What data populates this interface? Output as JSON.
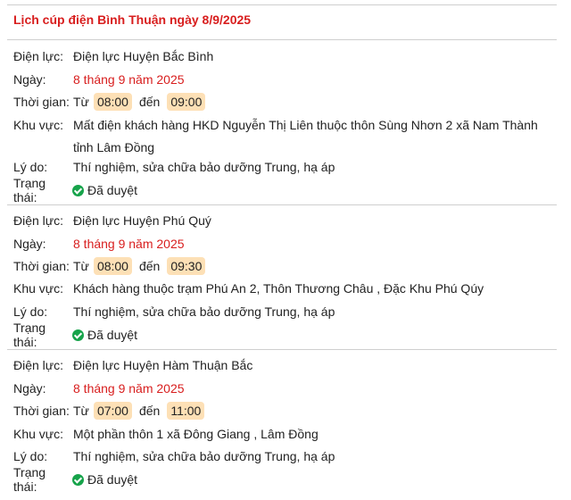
{
  "page_title": "Lịch cúp điện Bình Thuận ngày 8/9/2025",
  "labels": {
    "unit": "Điện lực:",
    "date": "Ngày:",
    "time": "Thời gian:",
    "area": "Khu vực:",
    "reason": "Lý do:",
    "status": "Trạng thái:",
    "from": "Từ",
    "to": "đến"
  },
  "colors": {
    "accent_red": "#d81e1e",
    "time_pill": "#fde0b6",
    "status_green": "#16a34a",
    "divider": "#cfcfcf"
  },
  "entries": [
    {
      "unit": "Điện lực Huyện Bắc Bình",
      "date": "8 tháng 9 năm 2025",
      "start": "08:00",
      "end": "09:00",
      "area": "Mất điện khách hàng HKD Nguyễn Thị Liên thuộc thôn Sùng Nhơn 2 xã Nam Thành tỉnh Lâm Đồng",
      "reason": "Thí nghiệm, sửa chữa bảo dưỡng Trung, hạ áp",
      "status": "Đã duyệt",
      "status_icon": "check-circle-icon"
    },
    {
      "unit": "Điện lực Huyện Phú Quý",
      "date": "8 tháng 9 năm 2025",
      "start": "08:00",
      "end": "09:30",
      "area": "Khách hàng thuộc trạm Phú An 2, Thôn Thương Châu , Đặc Khu Phú Qúy",
      "reason": "Thí nghiệm, sửa chữa bảo dưỡng Trung, hạ áp",
      "status": "Đã duyệt",
      "status_icon": "check-circle-icon"
    },
    {
      "unit": "Điện lực Huyện Hàm Thuận Bắc",
      "date": "8 tháng 9 năm 2025",
      "start": "07:00",
      "end": "11:00",
      "area": "Một phần thôn 1 xã Đông Giang , Lâm Đồng",
      "reason": "Thí nghiệm, sửa chữa bảo dưỡng Trung, hạ áp",
      "status": "Đã duyệt",
      "status_icon": "check-circle-icon"
    }
  ]
}
